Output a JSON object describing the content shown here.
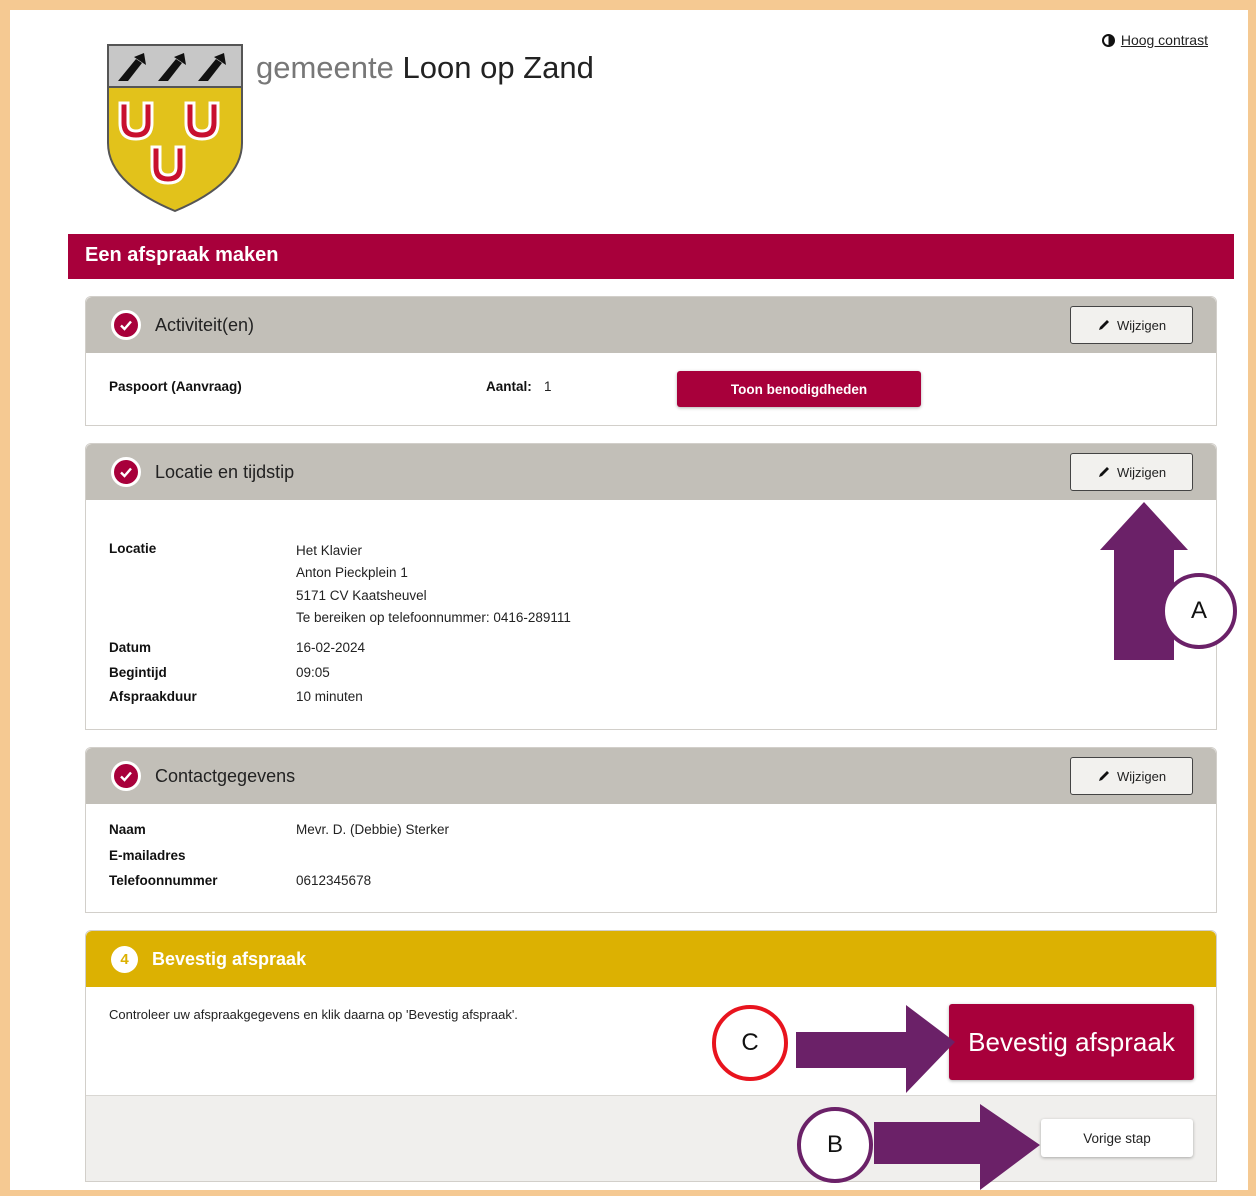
{
  "header": {
    "contrast_link": "Hoog contrast",
    "brand_prefix": "gemeente",
    "brand_name": "Loon op Zand"
  },
  "page_title": "Een afspraak maken",
  "activities": {
    "title": "Activiteit(en)",
    "edit_label": "Wijzigen",
    "item": "Paspoort (Aanvraag)",
    "count_label": "Aantal:",
    "count_value": "1",
    "show_button": "Toon benodigdheden"
  },
  "location": {
    "title": "Locatie en tijdstip",
    "edit_label": "Wijzigen",
    "location_label": "Locatie",
    "address_lines": [
      "Het Klavier",
      "Anton Pieckplein 1",
      "5171 CV Kaatsheuvel",
      "Te bereiken op telefoonnummer: 0416-289111"
    ],
    "date_label": "Datum",
    "date_value": "16-02-2024",
    "start_label": "Begintijd",
    "start_value": "09:05",
    "duration_label": "Afspraakduur",
    "duration_value": "10 minuten"
  },
  "contact": {
    "title": "Contactgegevens",
    "edit_label": "Wijzigen",
    "name_label": "Naam",
    "name_value": "Mevr. D. (Debbie) Sterker",
    "email_label": "E-mailadres",
    "phone_label": "Telefoonnummer",
    "phone_value": "0612345678"
  },
  "confirm": {
    "step_number": "4",
    "title": "Bevestig afspraak",
    "instruction": "Controleer uw afspraakgegevens en klik daarna op 'Bevestig afspraak'.",
    "confirm_button": "Bevestig afspraak",
    "back_button": "Vorige stap"
  },
  "annotations": {
    "a": "A",
    "b": "B",
    "c": "C"
  },
  "colors": {
    "brand_red": "#a8003b",
    "gold": "#dcb102",
    "panel_grey": "#c2bfb8",
    "arrow_purple": "#6b2168",
    "frame": "#f5c992"
  }
}
